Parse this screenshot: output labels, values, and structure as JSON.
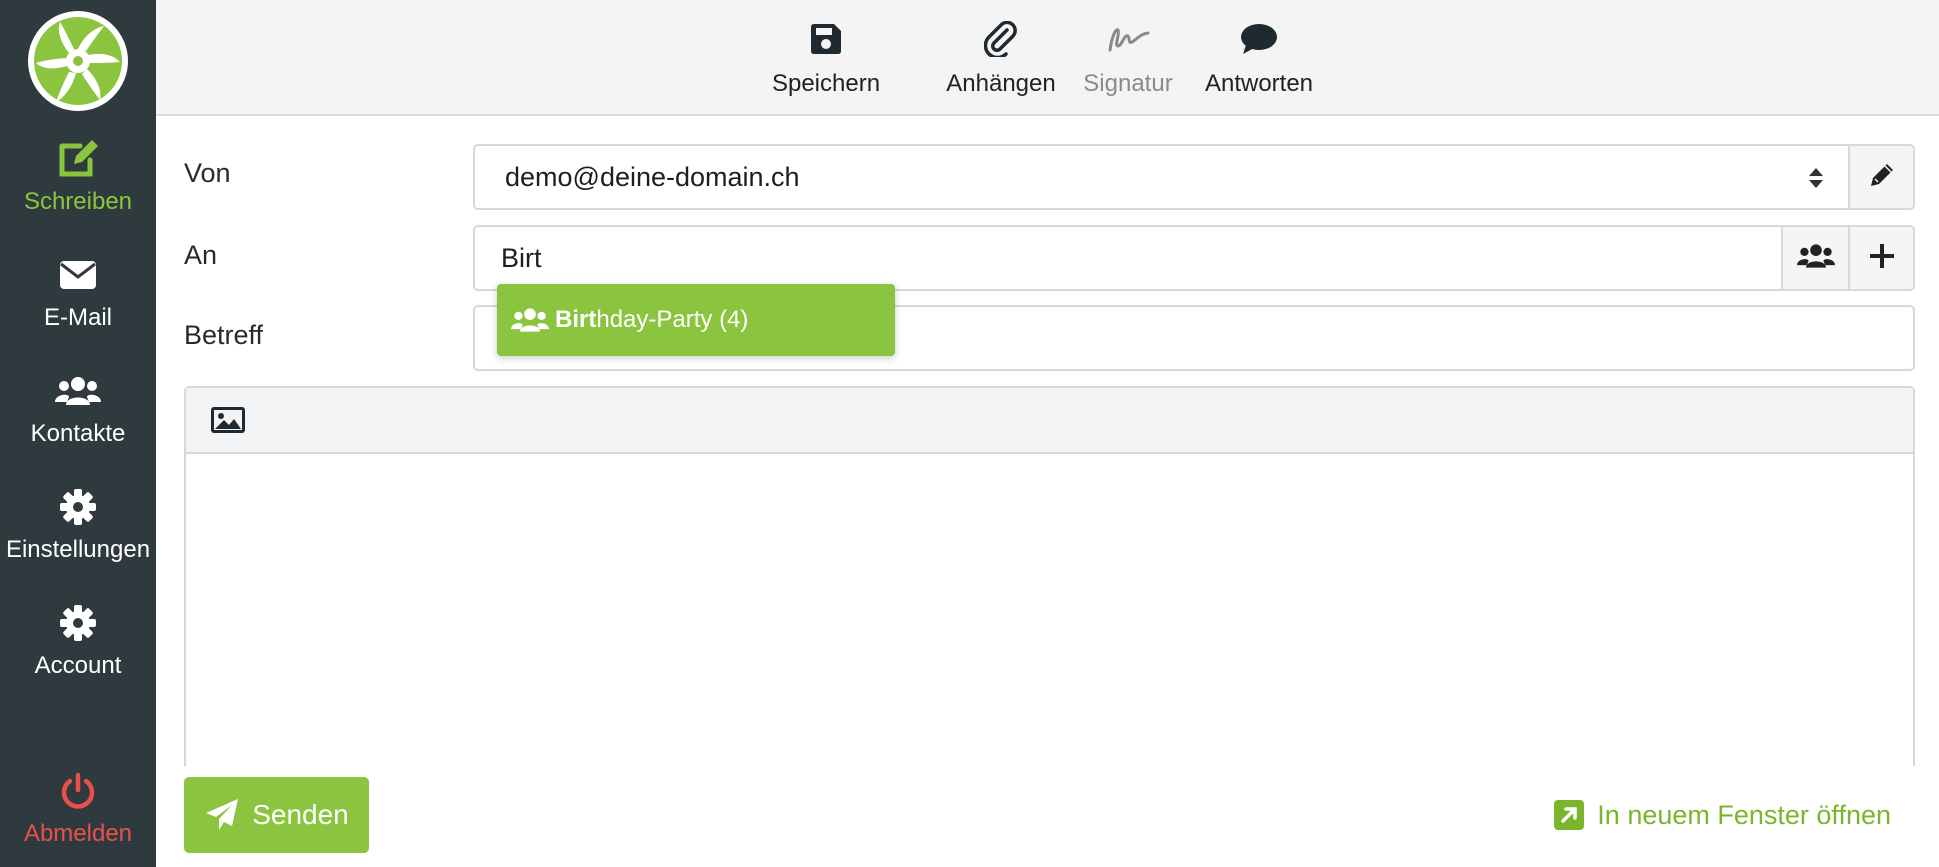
{
  "sidebar": {
    "items": [
      {
        "label": "Schreiben",
        "icon": "edit-icon",
        "active": true
      },
      {
        "label": "E-Mail",
        "icon": "envelope-icon"
      },
      {
        "label": "Kontakte",
        "icon": "users-icon"
      },
      {
        "label": "Einstellungen",
        "icon": "gear-icon"
      },
      {
        "label": "Account",
        "icon": "gear-icon"
      }
    ],
    "logout": {
      "label": "Abmelden",
      "icon": "power-icon"
    }
  },
  "toolbar": {
    "save": {
      "label": "Speichern",
      "icon": "floppy-icon"
    },
    "attach": {
      "label": "Anhängen",
      "icon": "paperclip-icon"
    },
    "signature": {
      "label": "Signatur",
      "icon": "signature-icon",
      "disabled": true
    },
    "reply": {
      "label": "Antworten",
      "icon": "speech-bubble-icon"
    }
  },
  "form": {
    "from": {
      "label": "Von",
      "value": "demo@deine-domain.ch"
    },
    "to": {
      "label": "An",
      "value": "Birt"
    },
    "subject": {
      "label": "Betreff",
      "value": ""
    }
  },
  "autocomplete": {
    "match": "Birt",
    "rest": "hday-Party (4)"
  },
  "actions": {
    "send_label": "Senden",
    "popout_label": "In neuem Fenster öffnen"
  },
  "colors": {
    "accent": "#8bc53f",
    "sidebar": "#2f3a3f",
    "danger": "#e8514b"
  }
}
